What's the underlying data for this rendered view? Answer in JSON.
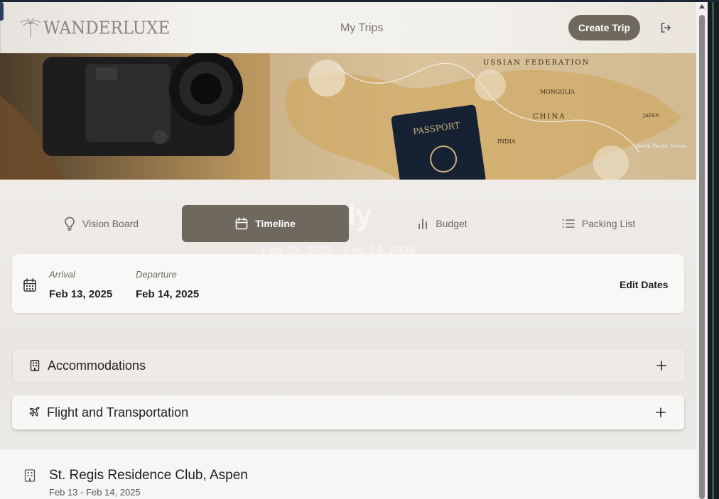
{
  "header": {
    "logo_text": "WANDERLUXE",
    "nav_my_trips": "My Trips",
    "create_trip_label": "Create Trip",
    "logout_icon": "logout-icon"
  },
  "hero": {
    "map_labels": [
      "USSIAN FEDERATION",
      "MONGOLIA",
      "CHINA",
      "INDIA",
      "JAPAN",
      "North Pacific Ocean"
    ],
    "passport_text": "PASSPORT"
  },
  "trip": {
    "title": "Italy",
    "range": "Feb 13, 2025 - Feb 14, 2025"
  },
  "tabs": [
    {
      "label": "Vision Board",
      "icon": "lightbulb-icon",
      "active": false
    },
    {
      "label": "Timeline",
      "icon": "calendar-icon",
      "active": true
    },
    {
      "label": "Budget",
      "icon": "bar-chart-icon",
      "active": false
    },
    {
      "label": "Packing List",
      "icon": "list-icon",
      "active": false
    }
  ],
  "dates": {
    "arrival_label": "Arrival",
    "arrival_value": "Feb 13, 2025",
    "departure_label": "Departure",
    "departure_value": "Feb 14, 2025",
    "edit_label": "Edit Dates"
  },
  "sections": [
    {
      "title": "Accommodations",
      "icon": "building-icon"
    },
    {
      "title": "Flight and Transportation",
      "icon": "plane-icon"
    }
  ],
  "items": [
    {
      "title": "St. Regis Residence Club, Aspen",
      "dates": "Feb 13 - Feb 14, 2025",
      "icon": "building-icon"
    }
  ],
  "colors": {
    "accent": "#6e685d",
    "background": "#eeeae6"
  }
}
